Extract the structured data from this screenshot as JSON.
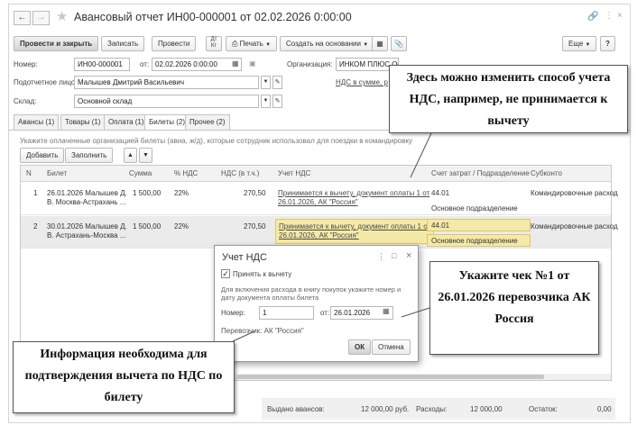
{
  "window": {
    "title": "Авансовый отчет ИН00-000001 от 02.02.2026 0:00:00"
  },
  "toolbar": {
    "post_close": "Провести и закрыть",
    "save": "Записать",
    "post": "Провести",
    "print": "Печать",
    "create_based": "Создать на основании",
    "more": "Еще",
    "help": "?"
  },
  "form": {
    "number_label": "Номер:",
    "number_value": "ИН00-000001",
    "date_label": "от:",
    "date_value": "02.02.2026  0:00:00",
    "org_label": "Организация:",
    "org_value": "ИНКОМ ПЛЮС ООО",
    "person_label": "Подотчетное лицо:",
    "person_value": "Малышев Дмитрий Васильевич",
    "vat_link": "НДС в сумме, р",
    "warehouse_label": "Склад:",
    "warehouse_value": "Основной склад"
  },
  "tabs": [
    {
      "label": "Авансы (1)"
    },
    {
      "label": "Товары (1)"
    },
    {
      "label": "Оплата (1)"
    },
    {
      "label": "Билеты (2)"
    },
    {
      "label": "Прочее (2)"
    }
  ],
  "tickets_tab": {
    "hint": "Укажите оплаченные организацией билеты (авиа, ж/д), которые сотрудник использовал для поездки в командировку",
    "add_button": "Добавить",
    "fill_button": "Заполнить",
    "columns": [
      "N",
      "Билет",
      "Сумма",
      "% НДС",
      "НДС (в т.ч.)",
      "Учет НДС",
      "Счет затрат / Подразделение",
      "Субконто"
    ],
    "rows": [
      {
        "n": "1",
        "ticket1": "26.01.2026 Малышев Д.",
        "ticket2": "В. Москва-Астрахань ...",
        "sum": "1 500,00",
        "vat_rate": "22%",
        "vat": "270,50",
        "vat_acc1": "Принимается к вычету, документ оплаты 1 от",
        "vat_acc2": "26.01.2026, АК \"Россия\"",
        "account": "44.01",
        "division": "Основное подразделение",
        "subconto": "Командировочные расход"
      },
      {
        "n": "2",
        "ticket1": "30.01.2026 Малышев Д.",
        "ticket2": "В. Астрахань-Москва ...",
        "sum": "1 500,00",
        "vat_rate": "22%",
        "vat": "270,50",
        "vat_acc1": "Принимается к вычету, документ оплаты 1 от",
        "vat_acc2": "26.01.2026, АК \"Россия\"",
        "account": "44.01",
        "division": "Основное подразделение",
        "subconto": "Командировочные расход"
      }
    ]
  },
  "footer": {
    "issued_label": "Выдано авансов:",
    "issued_value": "12 000,00",
    "currency": "руб.",
    "expenses_label": "Расходы:",
    "expenses_value": "12 000,00",
    "balance_label": "Остаток:",
    "balance_value": "0,00"
  },
  "dialog": {
    "title": "Учет НДС",
    "checkbox_label": "Принять к вычету",
    "checked": true,
    "hint": "Для включения расхода в книгу покупок укажите номер и дату документа оплаты билета",
    "number_label": "Номер:",
    "number_value": "1",
    "date_label": "от:",
    "date_value": "26.01.2026",
    "carrier": "Перевозчик: АК \"Россия\"",
    "ok": "ОК",
    "cancel": "Отмена"
  },
  "callouts": {
    "vat_method": "Здесь можно изменить способ учета НДС, например, не принимается к вычету",
    "receipt": "Укажите чек №1 от 26.01.2026 перевозчика АК Россия",
    "info": "Информация необходима для подтверждения вычета по НДС по билету"
  },
  "colors": {
    "highlight_row": "#ebebeb",
    "accent_yellow": "#f5e9a8"
  }
}
